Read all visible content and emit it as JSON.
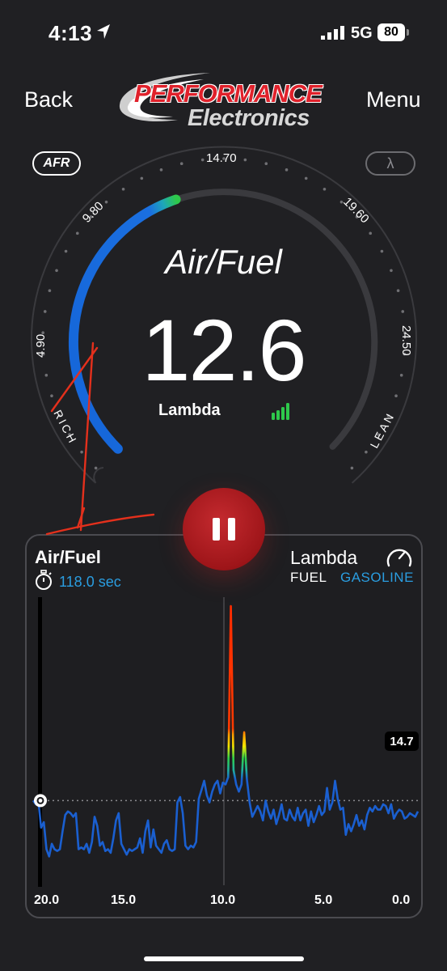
{
  "status_bar": {
    "time": "4:13",
    "network": "5G",
    "battery": "80"
  },
  "header": {
    "back_label": "Back",
    "menu_label": "Menu",
    "logo_line1": "PERFORMANCE",
    "logo_line2": "Electronics"
  },
  "gauge": {
    "mode_afr_label": "AFR",
    "mode_lambda_label": "λ",
    "title": "Air/Fuel",
    "value": "12.6",
    "sub_label": "Lambda",
    "rich_label": "RICH",
    "lean_label": "LEAN",
    "tick_labels": [
      "4.90",
      "9.80",
      "14.70",
      "19.60",
      "24.50"
    ],
    "scale_min": 4.9,
    "scale_max": 24.5,
    "current": 12.6,
    "colors": {
      "arc": "#1565d8",
      "arc_end": "#2ec84b",
      "signal": "#2ec84b",
      "track": "#3a3a3e"
    }
  },
  "controls": {
    "pause_icon": "pause-icon"
  },
  "chart_card": {
    "title": "Air/Fuel",
    "timer": "118.0 sec",
    "right_title": "Lambda",
    "fuel_label": "FUEL",
    "fuel_value": "GASOLINE",
    "reference_badge": "14.7",
    "x_tick_labels": [
      "20.0",
      "15.0",
      "10.0",
      "5.0",
      "0.0"
    ]
  },
  "chart_data": {
    "type": "line",
    "xlabel": "",
    "ylabel": "",
    "x_range": [
      20.0,
      0.0
    ],
    "y_range": [
      10,
      26
    ],
    "reference_line": 14.7,
    "series": [
      {
        "values": [
          14.7,
          14.5,
          14.6,
          13.2,
          13.5,
          12.0,
          11.6,
          12.3,
          12.0,
          11.9,
          12.0,
          13.0,
          13.9,
          14.1,
          14.0,
          13.8,
          14.0,
          12.0,
          12.1,
          12.0,
          12.3,
          11.8,
          12.4,
          13.8,
          13.3,
          12.2,
          12.4,
          11.9,
          12.0,
          11.8,
          12.6,
          13.6,
          14.0,
          12.3,
          12.0,
          11.7,
          12.0,
          11.9,
          12.0,
          12.1,
          12.6,
          11.8,
          13.0,
          13.6,
          12.1,
          13.1,
          12.2,
          12.0,
          11.8,
          12.3,
          12.5,
          12.0,
          11.9,
          12.0,
          14.6,
          14.9,
          14.0,
          12.2,
          12.0,
          12.2,
          12.1,
          12.4,
          14.8,
          15.3,
          15.8,
          15.0,
          14.6,
          15.2,
          15.6,
          15.8,
          15.1,
          15.7,
          15.6,
          16.0,
          25.5,
          16.4,
          15.6,
          15.2,
          15.6,
          18.5,
          15.9,
          14.6,
          13.8,
          14.1,
          14.4,
          14.1,
          13.6,
          14.7,
          14.1,
          13.7,
          14.2,
          13.4,
          13.9,
          14.5,
          13.7,
          13.6,
          14.2,
          13.8,
          13.6,
          14.3,
          13.6,
          14.0,
          14.2,
          13.3,
          14.1,
          13.5,
          13.9,
          14.4,
          13.9,
          14.1,
          15.4,
          14.2,
          14.6,
          15.8,
          14.8,
          14.2,
          14.3,
          12.8,
          13.4,
          13.0,
          13.4,
          13.9,
          13.3,
          13.6,
          13.1,
          13.9,
          14.3,
          14.1,
          14.4,
          14.2,
          14.2,
          14.5,
          14.4,
          14.0,
          14.5,
          13.7,
          14.0,
          14.2,
          14.1,
          13.7,
          13.8,
          14.0,
          13.9,
          13.8,
          14.1
        ]
      }
    ]
  }
}
